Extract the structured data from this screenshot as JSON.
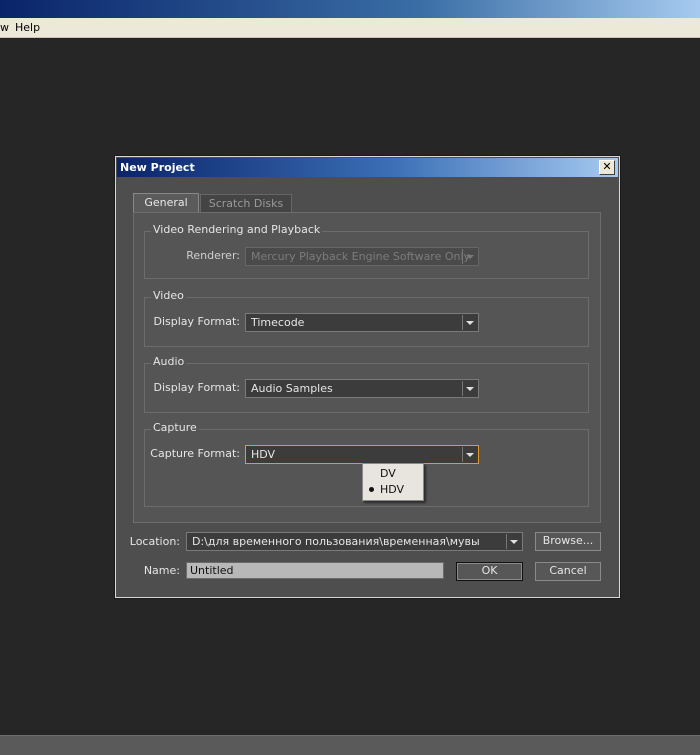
{
  "menubar": {
    "items": [
      "w",
      "Help"
    ]
  },
  "dialog": {
    "title": "New Project",
    "close_symbol": "✕",
    "tabs": [
      {
        "label": "General",
        "active": true
      },
      {
        "label": "Scratch Disks",
        "active": false
      }
    ],
    "groups": {
      "video_rendering": {
        "label": "Video Rendering and Playback",
        "renderer_label": "Renderer:",
        "renderer_value": "Mercury Playback Engine Software Only"
      },
      "video": {
        "label": "Video",
        "display_format_label": "Display Format:",
        "display_format_value": "Timecode"
      },
      "audio": {
        "label": "Audio",
        "display_format_label": "Display Format:",
        "display_format_value": "Audio Samples"
      },
      "capture": {
        "label": "Capture",
        "capture_format_label": "Capture Format:",
        "capture_format_value": "HDV",
        "options": [
          "DV",
          "HDV"
        ],
        "selected_option": "HDV"
      }
    },
    "location": {
      "label": "Location:",
      "value": "D:\\для временного пользования\\временная\\мувы",
      "browse_label": "Browse..."
    },
    "name": {
      "label": "Name:",
      "value": "Untitled"
    },
    "ok_label": "OK",
    "cancel_label": "Cancel"
  },
  "colors": {
    "accent_focus": "#e39a2a",
    "dialog_bg": "#4e4e4e",
    "title_gradient_start": "#0a246a"
  }
}
